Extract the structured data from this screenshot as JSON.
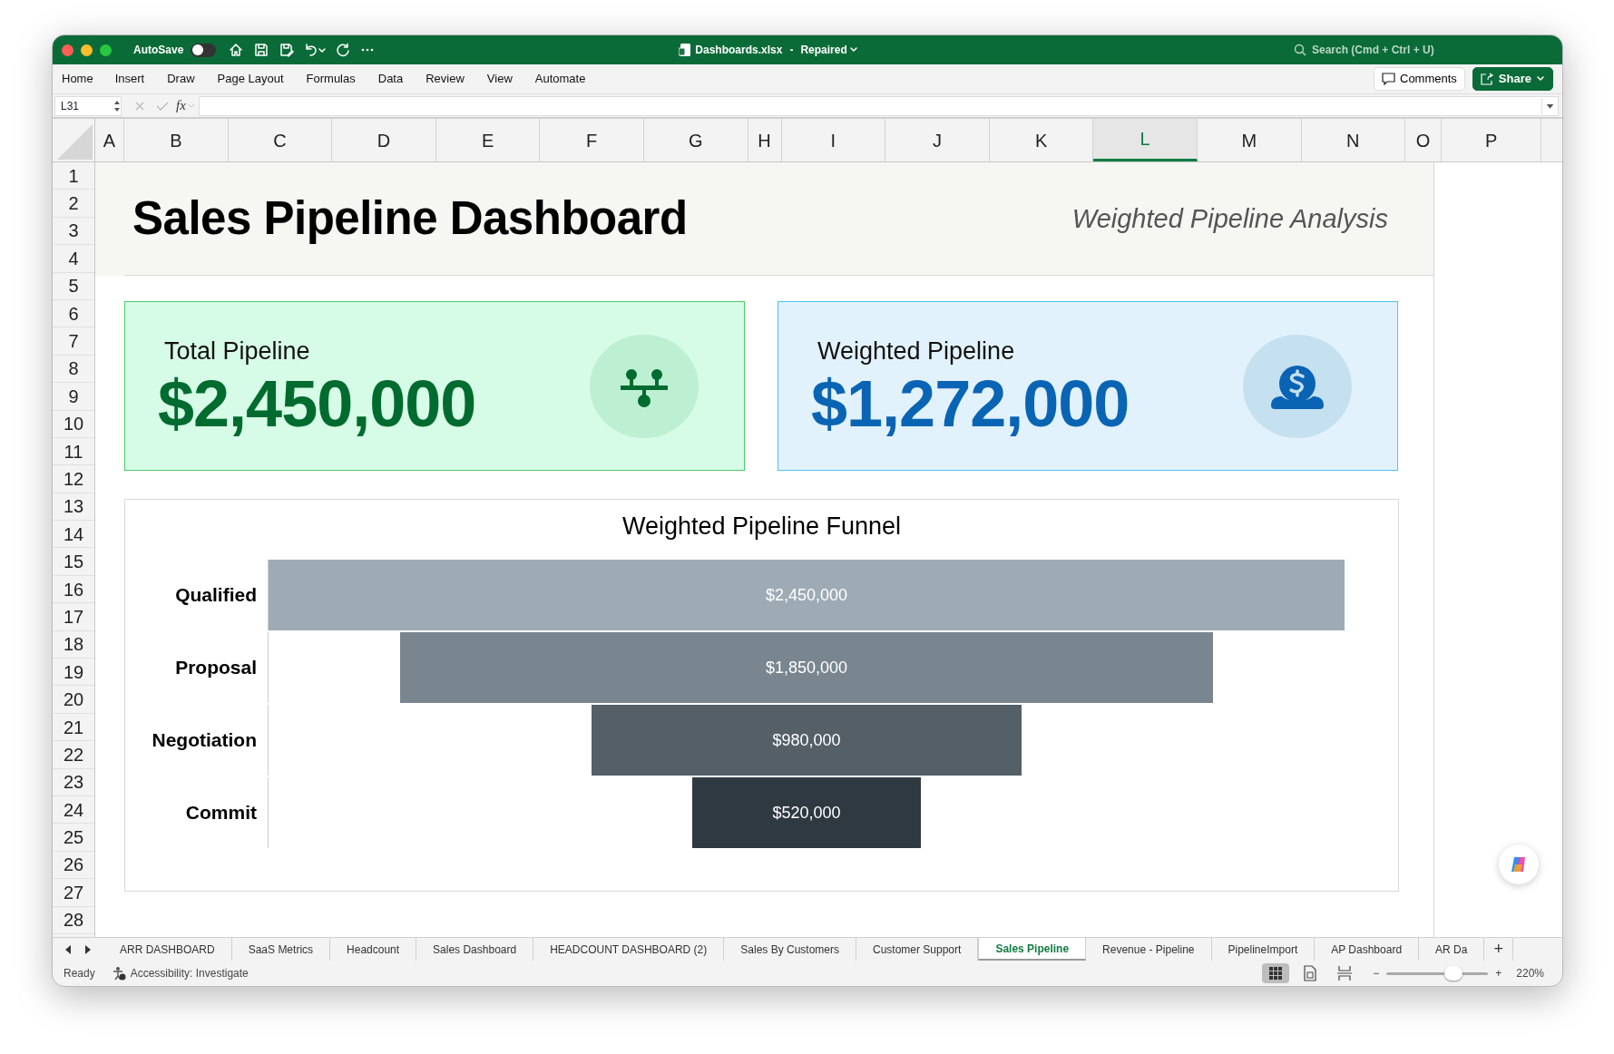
{
  "window": {
    "title": "Dashboards.xlsx",
    "title_separator": "-",
    "title_status": "Repaired",
    "autosave_label": "AutoSave",
    "autosave_on": false,
    "search_placeholder": "Search (Cmd + Ctrl + U)"
  },
  "ribbon_tabs": [
    "Home",
    "Insert",
    "Draw",
    "Page Layout",
    "Formulas",
    "Data",
    "Review",
    "View",
    "Automate"
  ],
  "comments_button": "Comments",
  "share_button": "Share",
  "formula_bar": {
    "name_box": "L31",
    "fx": "fx"
  },
  "columns": [
    {
      "label": "A",
      "selected": false
    },
    {
      "label": "B",
      "selected": false
    },
    {
      "label": "C",
      "selected": false
    },
    {
      "label": "D",
      "selected": false
    },
    {
      "label": "E",
      "selected": false
    },
    {
      "label": "F",
      "selected": false
    },
    {
      "label": "G",
      "selected": false
    },
    {
      "label": "H",
      "selected": false
    },
    {
      "label": "I",
      "selected": false
    },
    {
      "label": "J",
      "selected": false
    },
    {
      "label": "K",
      "selected": false
    },
    {
      "label": "L",
      "selected": true
    },
    {
      "label": "M",
      "selected": false
    },
    {
      "label": "N",
      "selected": false
    },
    {
      "label": "O",
      "selected": false
    },
    {
      "label": "P",
      "selected": false
    }
  ],
  "rows": [
    "1",
    "2",
    "3",
    "4",
    "5",
    "6",
    "7",
    "8",
    "9",
    "10",
    "11",
    "12",
    "13",
    "14",
    "15",
    "16",
    "17",
    "18",
    "19",
    "20",
    "21",
    "22",
    "23",
    "24",
    "25",
    "26",
    "27",
    "28"
  ],
  "dashboard": {
    "title": "Sales Pipeline Dashboard",
    "subtitle": "Weighted Pipeline Analysis",
    "kpis": [
      {
        "kind": "total",
        "label": "Total Pipeline",
        "value": "$2,450,000"
      },
      {
        "kind": "weighted",
        "label": "Weighted Pipeline",
        "value": "$1,272,000"
      }
    ],
    "funnel": {
      "title": "Weighted Pipeline Funnel",
      "stages": [
        {
          "label": "Qualified",
          "value": "$2,450,000"
        },
        {
          "label": "Proposal",
          "value": "$1,850,000"
        },
        {
          "label": "Negotiation",
          "value": "$980,000"
        },
        {
          "label": "Commit",
          "value": "$520,000"
        }
      ]
    }
  },
  "sheet_tabs": [
    {
      "label": "ARR DASHBOARD",
      "selected": false
    },
    {
      "label": "SaaS Metrics",
      "selected": false
    },
    {
      "label": "Headcount",
      "selected": false
    },
    {
      "label": "Sales Dashboard",
      "selected": false
    },
    {
      "label": "HEADCOUNT DASHBOARD (2)",
      "selected": false
    },
    {
      "label": "Sales By Customers",
      "selected": false
    },
    {
      "label": "Customer Support",
      "selected": false
    },
    {
      "label": "Sales Pipeline",
      "selected": true
    },
    {
      "label": "Revenue - Pipeline",
      "selected": false
    },
    {
      "label": "PipelineImport",
      "selected": false
    },
    {
      "label": "AP Dashboard",
      "selected": false
    },
    {
      "label": "AR Da",
      "selected": false
    }
  ],
  "add_sheet": "+",
  "status_bar": {
    "ready": "Ready",
    "accessibility": "Accessibility: Investigate",
    "views": [
      {
        "kind": "normal",
        "selected": true
      },
      {
        "kind": "page_layout",
        "selected": false
      },
      {
        "kind": "page_break",
        "selected": false
      }
    ],
    "zoom_out": "−",
    "zoom_slider": {
      "level": 0.66
    },
    "zoom_in": "+",
    "zoom": "220%"
  }
}
